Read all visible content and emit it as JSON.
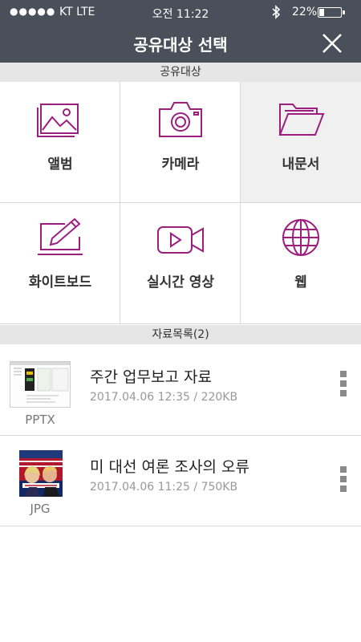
{
  "status_bar": {
    "signal_dots": "●●●●●",
    "carrier": "KT LTE",
    "time": "오전 11:22",
    "battery_percent": "22%",
    "battery_level": 0.22,
    "icons": [
      "bluetooth-icon",
      "battery-icon"
    ]
  },
  "header": {
    "title": "공유대상 선택",
    "close_icon": "close-icon"
  },
  "targets": {
    "section_label": "공유대상",
    "items": [
      {
        "label": "앨범",
        "icon": "album-icon"
      },
      {
        "label": "카메라",
        "icon": "camera-icon"
      },
      {
        "label": "내문서",
        "icon": "folder-icon",
        "selected": true
      },
      {
        "label": "화이트보드",
        "icon": "whiteboard-icon"
      },
      {
        "label": "실시간 영상",
        "icon": "video-icon"
      },
      {
        "label": "웹",
        "icon": "globe-icon"
      }
    ]
  },
  "files": {
    "section_label": "자료목록(2)",
    "items": [
      {
        "name": "주간 업무보고 자료",
        "meta": "2017.04.06 12:35 / 220KB",
        "type": "PPTX"
      },
      {
        "name": "미 대선 여론 조사의 오류",
        "meta": "2017.04.06 11:25 / 750KB",
        "type": "JPG"
      }
    ]
  },
  "colors": {
    "header_bg": "#4a5059",
    "accent": "#9c1f7f",
    "section_bg": "#e6e6e6"
  }
}
